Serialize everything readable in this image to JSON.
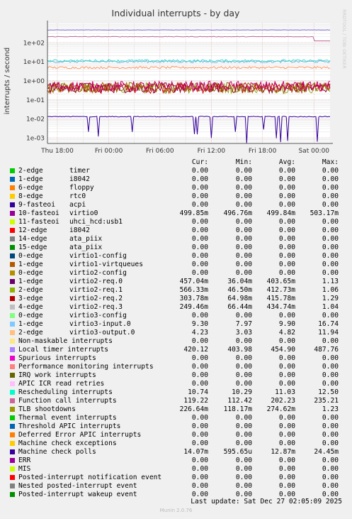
{
  "chart_data": {
    "type": "line",
    "title": "Individual interrupts - by day",
    "ylabel": "interrupts / second",
    "yscale": "log",
    "ylim": [
      0.0005,
      1000
    ],
    "y_ticks": [
      "1e-03",
      "1e-02",
      "1e-01",
      "1e+00",
      "1e+01",
      "1e+02"
    ],
    "x_ticks": [
      "Thu 18:00",
      "Fri 00:00",
      "Fri 06:00",
      "Fri 12:00",
      "Fri 18:00",
      "Sat 00:00"
    ],
    "grid": true,
    "watermark": "RRDTOOL / TOBI OETIKER",
    "drawn_series": [
      {
        "name": "Machine check polls",
        "color": "#330099",
        "level": 0.0128
      },
      {
        "name": "virtio2-req.0",
        "color": "#cc0000",
        "level": 0.404
      },
      {
        "name": "virtio2-req.1",
        "color": "#8da619",
        "level": 0.413
      },
      {
        "name": "virtio2-req.2",
        "color": "#990033",
        "level": 0.416
      },
      {
        "name": "virtio2-req.3",
        "color": "#996600",
        "level": 0.435
      },
      {
        "name": "virtio3-output.0",
        "color": "#ff9966",
        "level": 4.82
      },
      {
        "name": "virtio3-input.0",
        "color": "#80b0e6",
        "level": 9.9
      },
      {
        "name": "Rescheduling interrupts",
        "color": "#33ddcc",
        "level": 11.03
      },
      {
        "name": "Function call interrupts",
        "color": "#bb6699",
        "level": 202.23
      },
      {
        "name": "Local timer interrupts",
        "color": "#8877dd",
        "level": 454.9
      },
      {
        "name": "virtio0",
        "color": "#cc0066",
        "level": 0.4998
      }
    ]
  },
  "legend": {
    "headers": {
      "cur": "Cur:",
      "min": "Min:",
      "avg": "Avg:",
      "max": "Max:"
    },
    "rows": [
      {
        "name": "2-edge",
        "label": "timer",
        "cur": "0.00",
        "min": "0.00",
        "avg": "0.00",
        "max": "0.00",
        "color": "#00cc00"
      },
      {
        "name": "1-edge",
        "label": "i8042",
        "cur": "0.00",
        "min": "0.00",
        "avg": "0.00",
        "max": "0.00",
        "color": "#0066b3"
      },
      {
        "name": "6-edge",
        "label": "floppy",
        "cur": "0.00",
        "min": "0.00",
        "avg": "0.00",
        "max": "0.00",
        "color": "#ff8000"
      },
      {
        "name": "8-edge",
        "label": "rtc0",
        "cur": "0.00",
        "min": "0.00",
        "avg": "0.00",
        "max": "0.00",
        "color": "#ffcc00"
      },
      {
        "name": "9-fasteoi",
        "label": "acpi",
        "cur": "0.00",
        "min": "0.00",
        "avg": "0.00",
        "max": "0.00",
        "color": "#330099"
      },
      {
        "name": "10-fasteoi",
        "label": "virtio0",
        "cur": "499.85m",
        "min": "496.76m",
        "avg": "499.84m",
        "max": "503.17m",
        "color": "#990099"
      },
      {
        "name": "11-fasteoi",
        "label": "uhci_hcd:usb1",
        "cur": "0.00",
        "min": "0.00",
        "avg": "0.00",
        "max": "0.00",
        "color": "#ccff00"
      },
      {
        "name": "12-edge",
        "label": "i8042",
        "cur": "0.00",
        "min": "0.00",
        "avg": "0.00",
        "max": "0.00",
        "color": "#ff0000"
      },
      {
        "name": "14-edge",
        "label": "ata_piix",
        "cur": "0.00",
        "min": "0.00",
        "avg": "0.00",
        "max": "0.00",
        "color": "#808080"
      },
      {
        "name": "15-edge",
        "label": "ata_piix",
        "cur": "0.00",
        "min": "0.00",
        "avg": "0.00",
        "max": "0.00",
        "color": "#008f00"
      },
      {
        "name": "0-edge",
        "label": "virtio1-config",
        "cur": "0.00",
        "min": "0.00",
        "avg": "0.00",
        "max": "0.00",
        "color": "#00487d"
      },
      {
        "name": "1-edge",
        "label": "virtio1-virtqueues",
        "cur": "0.00",
        "min": "0.00",
        "avg": "0.00",
        "max": "0.00",
        "color": "#b35a00"
      },
      {
        "name": "0-edge",
        "label": "virtio2-config",
        "cur": "0.00",
        "min": "0.00",
        "avg": "0.00",
        "max": "0.00",
        "color": "#b38f00"
      },
      {
        "name": "1-edge",
        "label": "virtio2-req.0",
        "cur": "457.04m",
        "min": "36.04m",
        "avg": "403.65m",
        "max": "1.13",
        "color": "#6b006b"
      },
      {
        "name": "2-edge",
        "label": "virtio2-req.1",
        "cur": "566.33m",
        "min": "46.50m",
        "avg": "412.73m",
        "max": "1.06",
        "color": "#8fb300"
      },
      {
        "name": "3-edge",
        "label": "virtio2-req.2",
        "cur": "303.78m",
        "min": "64.98m",
        "avg": "415.78m",
        "max": "1.29",
        "color": "#b30000"
      },
      {
        "name": "4-edge",
        "label": "virtio2-req.3",
        "cur": "249.46m",
        "min": "66.44m",
        "avg": "434.74m",
        "max": "1.04",
        "color": "#bebebe"
      },
      {
        "name": "0-edge",
        "label": "virtio3-config",
        "cur": "0.00",
        "min": "0.00",
        "avg": "0.00",
        "max": "0.00",
        "color": "#80ff80"
      },
      {
        "name": "1-edge",
        "label": "virtio3-input.0",
        "cur": "9.30",
        "min": "7.97",
        "avg": "9.90",
        "max": "16.74",
        "color": "#80c9ff"
      },
      {
        "name": "2-edge",
        "label": "virtio3-output.0",
        "cur": "4.23",
        "min": "3.03",
        "avg": "4.82",
        "max": "11.94",
        "color": "#ffc080"
      },
      {
        "name": "Non-maskable interrupts",
        "label": "",
        "cur": "0.00",
        "min": "0.00",
        "avg": "0.00",
        "max": "0.00",
        "color": "#ffe680"
      },
      {
        "name": "Local timer interrupts",
        "label": "",
        "cur": "420.12",
        "min": "403.98",
        "avg": "454.90",
        "max": "487.76",
        "color": "#aa80ff"
      },
      {
        "name": "Spurious interrupts",
        "label": "",
        "cur": "0.00",
        "min": "0.00",
        "avg": "0.00",
        "max": "0.00",
        "color": "#ee00cc"
      },
      {
        "name": "Performance monitoring interrupts",
        "label": "",
        "cur": "0.00",
        "min": "0.00",
        "avg": "0.00",
        "max": "0.00",
        "color": "#ff8080"
      },
      {
        "name": "IRQ work interrupts",
        "label": "",
        "cur": "0.00",
        "min": "0.00",
        "avg": "0.00",
        "max": "0.00",
        "color": "#666600"
      },
      {
        "name": "APIC ICR read retries",
        "label": "",
        "cur": "0.00",
        "min": "0.00",
        "avg": "0.00",
        "max": "0.00",
        "color": "#ffbfff"
      },
      {
        "name": "Rescheduling interrupts",
        "label": "",
        "cur": "10.74",
        "min": "10.29",
        "avg": "11.03",
        "max": "12.50",
        "color": "#00ffcc"
      },
      {
        "name": "Function call interrupts",
        "label": "",
        "cur": "119.22",
        "min": "112.42",
        "avg": "202.23",
        "max": "235.21",
        "color": "#cc6699"
      },
      {
        "name": "TLB shootdowns",
        "label": "",
        "cur": "226.64m",
        "min": "118.17m",
        "avg": "274.62m",
        "max": "1.23",
        "color": "#999900"
      },
      {
        "name": "Thermal event interrupts",
        "label": "",
        "cur": "0.00",
        "min": "0.00",
        "avg": "0.00",
        "max": "0.00",
        "color": "#00cc00"
      },
      {
        "name": "Threshold APIC interrupts",
        "label": "",
        "cur": "0.00",
        "min": "0.00",
        "avg": "0.00",
        "max": "0.00",
        "color": "#0066b3"
      },
      {
        "name": "Deferred Error APIC interrupts",
        "label": "",
        "cur": "0.00",
        "min": "0.00",
        "avg": "0.00",
        "max": "0.00",
        "color": "#ff8000"
      },
      {
        "name": "Machine check exceptions",
        "label": "",
        "cur": "0.00",
        "min": "0.00",
        "avg": "0.00",
        "max": "0.00",
        "color": "#ffcc00"
      },
      {
        "name": "Machine check polls",
        "label": "",
        "cur": "14.07m",
        "min": "595.65u",
        "avg": "12.87m",
        "max": "24.45m",
        "color": "#330099"
      },
      {
        "name": "ERR",
        "label": "",
        "cur": "0.00",
        "min": "0.00",
        "avg": "0.00",
        "max": "0.00",
        "color": "#990099"
      },
      {
        "name": "MIS",
        "label": "",
        "cur": "0.00",
        "min": "0.00",
        "avg": "0.00",
        "max": "0.00",
        "color": "#ccff00"
      },
      {
        "name": "Posted-interrupt notification event",
        "label": "",
        "cur": "0.00",
        "min": "0.00",
        "avg": "0.00",
        "max": "0.00",
        "color": "#ff0000"
      },
      {
        "name": "Nested posted-interrupt event",
        "label": "",
        "cur": "0.00",
        "min": "0.00",
        "avg": "0.00",
        "max": "0.00",
        "color": "#808080"
      },
      {
        "name": "Posted-interrupt wakeup event",
        "label": "",
        "cur": "0.00",
        "min": "0.00",
        "avg": "0.00",
        "max": "0.00",
        "color": "#008f00"
      }
    ]
  },
  "footer": {
    "last_update": "Last update: Sat Dec 27 02:05:09 2025",
    "version": "Munin 2.0.76"
  }
}
